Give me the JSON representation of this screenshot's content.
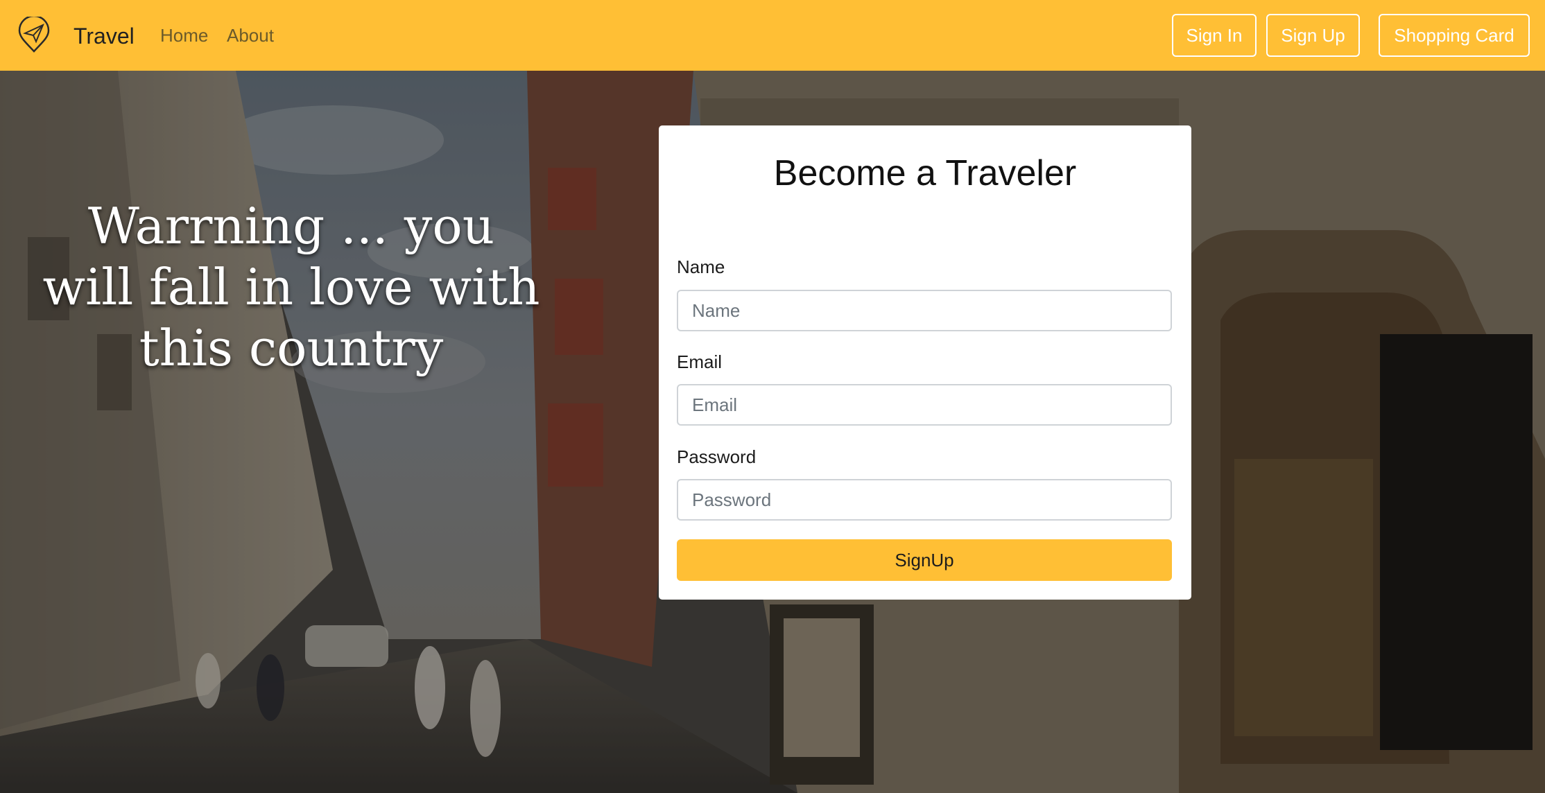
{
  "navbar": {
    "brand": "Travel",
    "links": [
      "Home",
      "About"
    ],
    "buttons": {
      "sign_in": "Sign In",
      "sign_up": "Sign Up",
      "cart": "Shopping Card"
    },
    "background_color": "#ffbf35"
  },
  "hero": {
    "headline": "Warrning ... you will fall in love with this country"
  },
  "signup_form": {
    "title": "Become a Traveler",
    "fields": [
      {
        "label": "Name",
        "placeholder": "Name",
        "value": ""
      },
      {
        "label": "Email",
        "placeholder": "Email",
        "value": ""
      },
      {
        "label": "Password",
        "placeholder": "Password",
        "value": ""
      }
    ],
    "submit_label": "SignUp",
    "accent_color": "#ffbf35"
  },
  "icons": {
    "logo": "paper-plane-pin-icon"
  }
}
